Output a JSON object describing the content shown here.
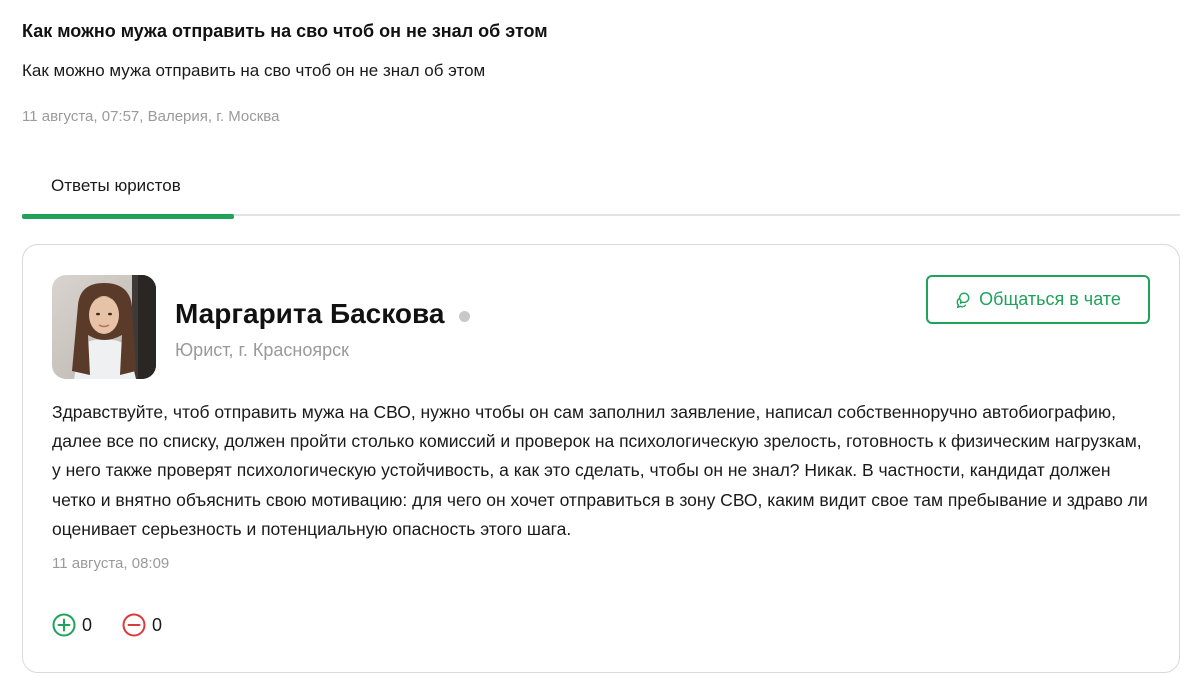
{
  "question": {
    "title": "Как можно мужа отправить на сво чтоб он не знал об этом",
    "body": "Как можно мужа отправить на сво чтоб он не знал об этом",
    "meta": "11 августа, 07:57, Валерия, г. Москва"
  },
  "tabs": [
    {
      "label": "Ответы юристов",
      "active": true
    }
  ],
  "answer": {
    "author": {
      "name": "Маргарита Баскова",
      "role": "Юрист, г. Красноярск",
      "status": "offline",
      "avatar_icon": "lawyer-photo"
    },
    "chat_button": {
      "label": "Общаться в чате",
      "icon": "chat-bubbles-icon"
    },
    "text": "Здравствуйте, чтоб отправить мужа на СВО, нужно чтобы он сам заполнил заявление, написал собственноручно автобиографию, далее все по списку, должен пройти столько комиссий и проверок на психологическую зрелость, готовность к физическим нагрузкам, у него также проверят психологическую устойчивость, а как это сделать, чтобы он не знал? Никак. В частности, кандидат должен четко и внятно объяснить свою мотивацию: для чего он хочет отправиться в зону СВО, каким видит свое там пребывание и здраво ли оценивает серьезность и потенциальную опасность этого шага.",
    "date": "11 августа, 08:09",
    "votes": {
      "up": "0",
      "down": "0"
    }
  },
  "colors": {
    "accent": "#1fa25a",
    "downvote": "#d93a3a",
    "muted_text": "#9a9a9a",
    "border": "#d9d9d9",
    "status_offline": "#c8c8c8"
  }
}
